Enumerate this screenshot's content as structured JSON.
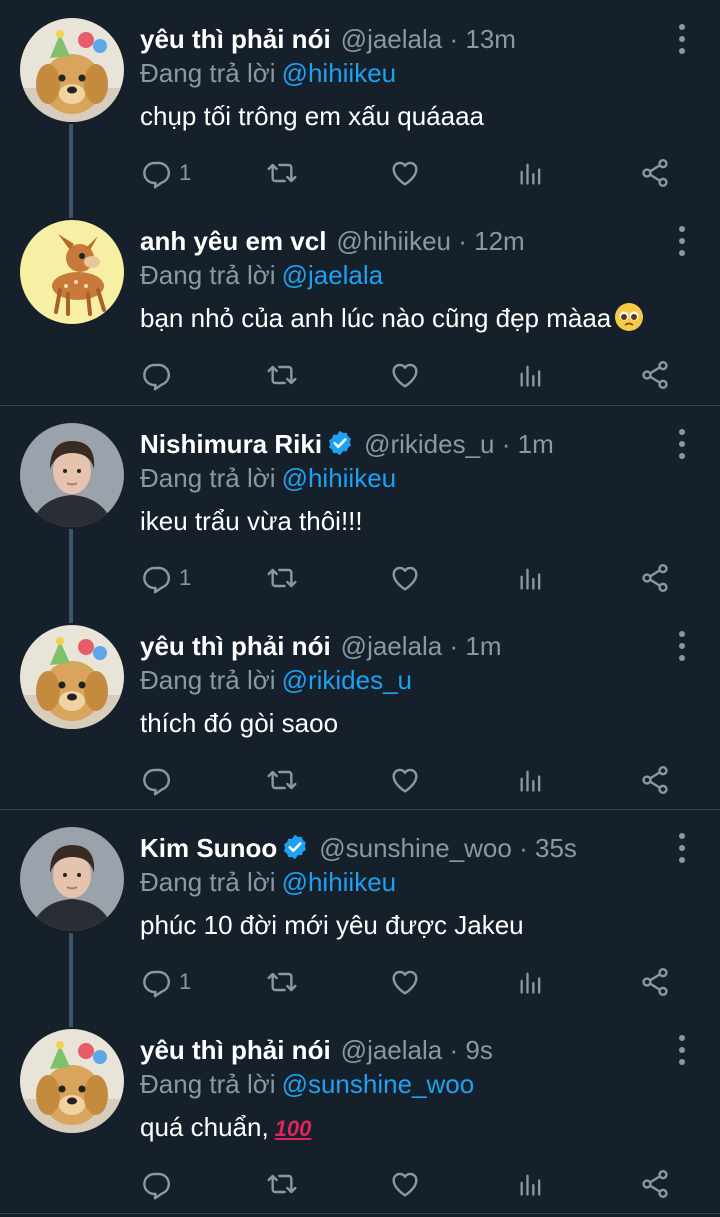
{
  "reply_prefix": "Đang trả lời",
  "colors": {
    "background": "#15202b",
    "muted": "#8899a6",
    "accent": "#1da1f2",
    "divider": "#38444d"
  },
  "icons": {
    "reply": "reply-icon",
    "retweet": "retweet-icon",
    "like": "heart-icon",
    "analytics": "analytics-icon",
    "share": "share-icon",
    "more": "more-vertical-icon",
    "verified": "verified-badge-icon"
  },
  "tweets": [
    {
      "name": "yêu thì phải nói",
      "handle": "@jaelala",
      "sep": "·",
      "time": "13m",
      "reply_to": "@hihiikeu",
      "text": "chụp tối trông em xấu quáaaa",
      "reply_count": "1",
      "verified": false,
      "avatar": "golden-retriever-puppy-avatar"
    },
    {
      "name": "anh yêu em vcl",
      "handle": "@hihiikeu",
      "sep": "·",
      "time": "12m",
      "reply_to": "@jaelala",
      "text": "bạn nhỏ của anh lúc nào cũng đẹp màaa",
      "reply_count": "",
      "verified": false,
      "avatar": "bambi-deer-avatar"
    },
    {
      "name": "Nishimura Riki",
      "handle": "@rikides_u",
      "sep": "·",
      "time": "1m",
      "reply_to": "@hihiikeu",
      "text": "ikeu trẩu vừa thôi!!!",
      "reply_count": "1",
      "verified": true,
      "avatar": "person-photo-avatar"
    },
    {
      "name": "yêu thì phải nói",
      "handle": "@jaelala",
      "sep": "·",
      "time": "1m",
      "reply_to": "@rikides_u",
      "text": "thích đó gòi saoo",
      "reply_count": "",
      "verified": false,
      "avatar": "golden-retriever-puppy-avatar"
    },
    {
      "name": "Kim Sunoo",
      "handle": "@sunshine_woo",
      "sep": "·",
      "time": "35s",
      "reply_to": "@hihiikeu",
      "text": "phúc 10 đời mới yêu được Jakeu",
      "reply_count": "1",
      "verified": true,
      "avatar": "person-photo-avatar"
    },
    {
      "name": "yêu thì phải nói",
      "handle": "@jaelala",
      "sep": "·",
      "time": "9s",
      "reply_to": "@sunshine_woo",
      "text": "quá chuẩn,",
      "reply_count": "",
      "verified": false,
      "avatar": "golden-retriever-puppy-avatar"
    }
  ],
  "emoji": {
    "t1": "pleading-face-emoji",
    "t5": "100"
  }
}
